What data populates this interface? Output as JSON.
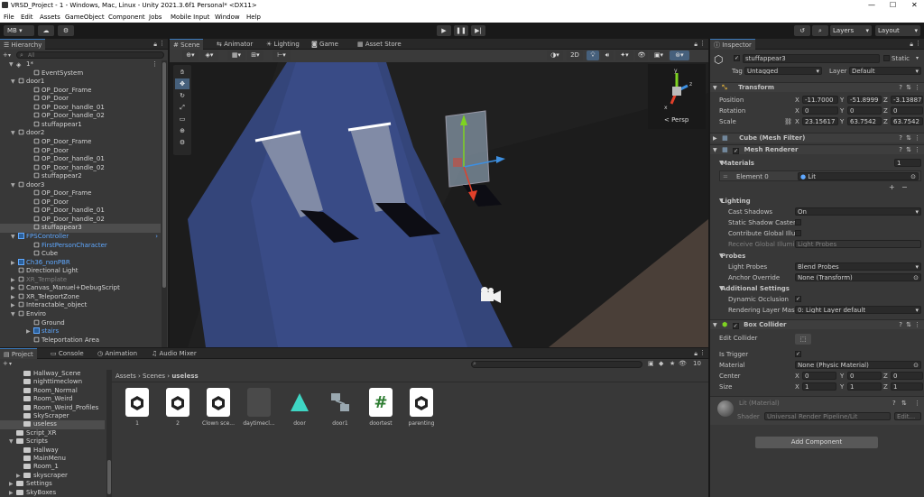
{
  "window": {
    "title": "VRSD_Project - 1 - Windows, Mac, Linux - Unity 2021.3.6f1 Personal* <DX11>"
  },
  "menu": [
    "File",
    "Edit",
    "Assets",
    "GameObject",
    "Component",
    "Jobs",
    "Mobile Input",
    "Window",
    "Help"
  ],
  "toolbar": {
    "account": "MB",
    "layers_label": "Layers",
    "layout_label": "Layout"
  },
  "hierarchy": {
    "tab_label": "Hierarchy",
    "add_label": "+",
    "search_placeholder": "All",
    "items": [
      {
        "label": "1*",
        "depth": 0,
        "kind": "scene"
      },
      {
        "label": "EventSystem",
        "depth": 2,
        "kind": "cube"
      },
      {
        "label": "door1",
        "depth": 1,
        "kind": "cube",
        "arrow": "▼"
      },
      {
        "label": "OP_Door_Frame",
        "depth": 2,
        "kind": "cube"
      },
      {
        "label": "OP_Door",
        "depth": 2,
        "kind": "cube"
      },
      {
        "label": "OP_Door_handle_01",
        "depth": 2,
        "kind": "cube"
      },
      {
        "label": "OP_Door_handle_02",
        "depth": 2,
        "kind": "cube"
      },
      {
        "label": "stuffappear1",
        "depth": 2,
        "kind": "cube"
      },
      {
        "label": "door2",
        "depth": 1,
        "kind": "cube",
        "arrow": "▼"
      },
      {
        "label": "OP_Door_Frame",
        "depth": 2,
        "kind": "cube"
      },
      {
        "label": "OP_Door",
        "depth": 2,
        "kind": "cube"
      },
      {
        "label": "OP_Door_handle_01",
        "depth": 2,
        "kind": "cube"
      },
      {
        "label": "OP_Door_handle_02",
        "depth": 2,
        "kind": "cube"
      },
      {
        "label": "stuffappear2",
        "depth": 2,
        "kind": "cube"
      },
      {
        "label": "door3",
        "depth": 1,
        "kind": "cube",
        "arrow": "▼"
      },
      {
        "label": "OP_Door_Frame",
        "depth": 2,
        "kind": "cube"
      },
      {
        "label": "OP_Door",
        "depth": 2,
        "kind": "cube"
      },
      {
        "label": "OP_Door_handle_01",
        "depth": 2,
        "kind": "cube"
      },
      {
        "label": "OP_Door_handle_02",
        "depth": 2,
        "kind": "cube"
      },
      {
        "label": "stuffappear3",
        "depth": 2,
        "kind": "cube",
        "selected": true
      },
      {
        "label": "FPSController",
        "depth": 1,
        "kind": "blue",
        "arrow": "▼",
        "color": "blue"
      },
      {
        "label": "FirstPersonCharacter",
        "depth": 2,
        "kind": "cube",
        "color": "blue"
      },
      {
        "label": "Cube",
        "depth": 2,
        "kind": "cube"
      },
      {
        "label": "Ch36_nonPBR",
        "depth": 1,
        "kind": "blue",
        "arrow": "▶",
        "color": "blue"
      },
      {
        "label": "Directional Light",
        "depth": 1,
        "kind": "cube"
      },
      {
        "label": "XR_Template",
        "depth": 1,
        "kind": "cube",
        "arrow": "▶",
        "color": "dim"
      },
      {
        "label": "Canvas_Manuel+DebugScript",
        "depth": 1,
        "kind": "cube",
        "arrow": "▶"
      },
      {
        "label": "XR_TeleportZone",
        "depth": 1,
        "kind": "cube",
        "arrow": "▶"
      },
      {
        "label": "Interactable_object",
        "depth": 1,
        "kind": "cube",
        "arrow": "▶"
      },
      {
        "label": "Enviro",
        "depth": 1,
        "kind": "cube",
        "arrow": "▼"
      },
      {
        "label": "Ground",
        "depth": 2,
        "kind": "cube"
      },
      {
        "label": "stairs",
        "depth": 2,
        "kind": "blue",
        "arrow": "▶",
        "color": "blue"
      },
      {
        "label": "Teleportation Area",
        "depth": 2,
        "kind": "cube"
      }
    ]
  },
  "scene_tabs": [
    {
      "label": "Scene",
      "active": true
    },
    {
      "label": "Animator"
    },
    {
      "label": "Lighting"
    },
    {
      "label": "Game"
    },
    {
      "label": "Asset Store"
    }
  ],
  "scene": {
    "mode_2d": "2D",
    "gizmo_label": "< Persp"
  },
  "project": {
    "tabs": [
      {
        "label": "Project",
        "active": true
      },
      {
        "label": "Console"
      },
      {
        "label": "Animation"
      },
      {
        "label": "Audio Mixer"
      }
    ],
    "add_label": "+",
    "breadcrumb": [
      "Assets",
      "Scenes",
      "useless"
    ],
    "count": "10",
    "tree": [
      {
        "label": "Hallway_Scene",
        "depth": 2
      },
      {
        "label": "nighttimeclown",
        "depth": 2
      },
      {
        "label": "Room_Normal",
        "depth": 2
      },
      {
        "label": "Room_Weird",
        "depth": 2
      },
      {
        "label": "Room_Weird_Profiles",
        "depth": 2
      },
      {
        "label": "SkyScraper",
        "depth": 2
      },
      {
        "label": "useless",
        "depth": 2,
        "selected": true
      },
      {
        "label": "Script_XR",
        "depth": 1
      },
      {
        "label": "Scripts",
        "depth": 1,
        "arrow": "▼"
      },
      {
        "label": "Hallway",
        "depth": 2
      },
      {
        "label": "MainMenu",
        "depth": 2
      },
      {
        "label": "Room_1",
        "depth": 2
      },
      {
        "label": "skyscraper",
        "depth": 2,
        "arrow": "▶"
      },
      {
        "label": "Settings",
        "depth": 1,
        "arrow": "▶"
      },
      {
        "label": "SkyBoxes",
        "depth": 1,
        "arrow": "▶"
      }
    ],
    "assets": [
      {
        "label": "1",
        "type": "unity"
      },
      {
        "label": "2",
        "type": "unity"
      },
      {
        "label": "Clown sce...",
        "type": "unity"
      },
      {
        "label": "daytimecl...",
        "type": "dark"
      },
      {
        "label": "door",
        "type": "animator"
      },
      {
        "label": "door1",
        "type": "controller"
      },
      {
        "label": "doortest",
        "type": "script"
      },
      {
        "label": "parenting",
        "type": "unity"
      }
    ]
  },
  "inspector": {
    "tab_label": "Inspector",
    "object_name": "stuffappear3",
    "static_label": "Static",
    "tag_label": "Tag",
    "tag_value": "Untagged",
    "layer_label": "Layer",
    "layer_value": "Default",
    "transform": {
      "title": "Transform",
      "position_label": "Position",
      "position": {
        "x": "-11.7000",
        "y": "-51.8999",
        "z": "-3.13887"
      },
      "rotation_label": "Rotation",
      "rotation": {
        "x": "0",
        "y": "0",
        "z": "0"
      },
      "scale_label": "Scale",
      "scale": {
        "x": "23.15617",
        "y": "63.7542",
        "z": "63.7542"
      }
    },
    "mesh_filter": {
      "title": "Cube (Mesh Filter)"
    },
    "mesh_renderer": {
      "title": "Mesh Renderer",
      "materials_label": "Materials",
      "materials_count": "1",
      "element0_label": "Element 0",
      "element0_value": "Lit",
      "lighting_label": "Lighting",
      "cast_shadows_label": "Cast Shadows",
      "cast_shadows_value": "On",
      "static_shadow_label": "Static Shadow Caster",
      "contribute_gi_label": "Contribute Global Illur",
      "receive_gi_label": "Receive Global Illumir",
      "receive_gi_value": "Light Probes",
      "probes_label": "Probes",
      "light_probes_label": "Light Probes",
      "light_probes_value": "Blend Probes",
      "anchor_label": "Anchor Override",
      "anchor_value": "None (Transform)",
      "additional_label": "Additional Settings",
      "dynamic_occlusion_label": "Dynamic Occlusion",
      "rendering_layer_label": "Rendering Layer Masi",
      "rendering_layer_value": "0: Light Layer default"
    },
    "box_collider": {
      "title": "Box Collider",
      "edit_label": "Edit Collider",
      "trigger_label": "Is Trigger",
      "material_label": "Material",
      "material_value": "None (Physic Material)",
      "center_label": "Center",
      "center": {
        "x": "0",
        "y": "0",
        "z": "0"
      },
      "size_label": "Size",
      "size": {
        "x": "1",
        "y": "1",
        "z": "1"
      }
    },
    "material": {
      "title": "Lit (Material)",
      "shader_label": "Shader",
      "shader_value": "Universal Render Pipeline/Lit",
      "edit_label": "Edit..."
    },
    "add_component_label": "Add Component"
  },
  "colors": {
    "accent": "#3a79bb",
    "selection_blue": "#5fa8ff",
    "panel": "#383838",
    "header": "#282828"
  }
}
